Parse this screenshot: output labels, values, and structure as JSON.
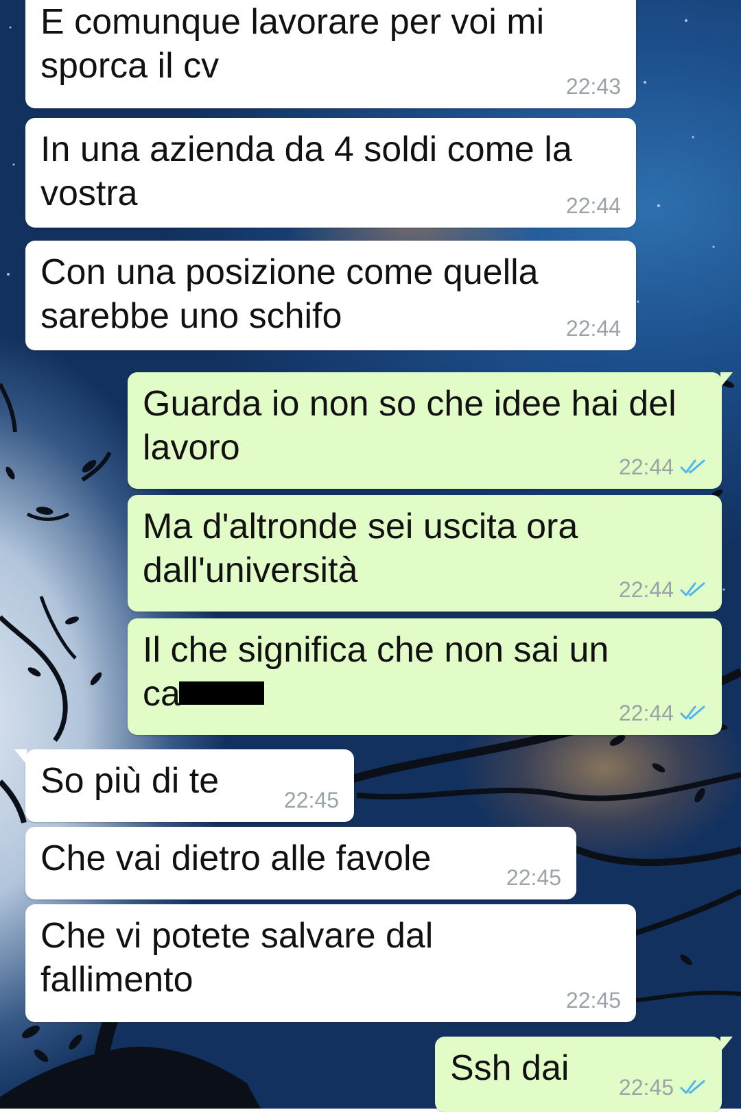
{
  "colors": {
    "incoming_bubble": "#ffffff",
    "outgoing_bubble": "#e2fcc8",
    "timestamp": "#9aa3a8",
    "read_ticks": "#4fb6ec"
  },
  "messages": [
    {
      "direction": "in",
      "text": "E comunque lavorare per voi mi\nsporca il cv",
      "time": "22:43"
    },
    {
      "direction": "in",
      "text": "In una azienda da 4 soldi come la\nvostra",
      "time": "22:44"
    },
    {
      "direction": "in",
      "text": "Con una posizione come quella\nsarebbe uno schifo",
      "time": "22:44"
    },
    {
      "direction": "out",
      "text": "Guarda io non so che idee hai del\nlavoro",
      "time": "22:44",
      "status_icon": "double-check-read-icon"
    },
    {
      "direction": "out",
      "text": "Ma d'altronde sei uscita ora\ndall'università",
      "time": "22:44",
      "status_icon": "double-check-read-icon"
    },
    {
      "direction": "out",
      "text_line1": "Il che significa che non sai un",
      "text_line2_visible": "ca",
      "redacted": true,
      "time": "22:44",
      "status_icon": "double-check-read-icon"
    },
    {
      "direction": "in",
      "text": "So più di te",
      "time": "22:45"
    },
    {
      "direction": "in",
      "text": "Che vai dietro alle favole",
      "time": "22:45"
    },
    {
      "direction": "in",
      "text": "Che vi potete salvare dal\nfallimento",
      "time": "22:45"
    },
    {
      "direction": "out",
      "text": "Ssh dai",
      "time": "22:45",
      "status_icon": "double-check-read-icon"
    }
  ]
}
